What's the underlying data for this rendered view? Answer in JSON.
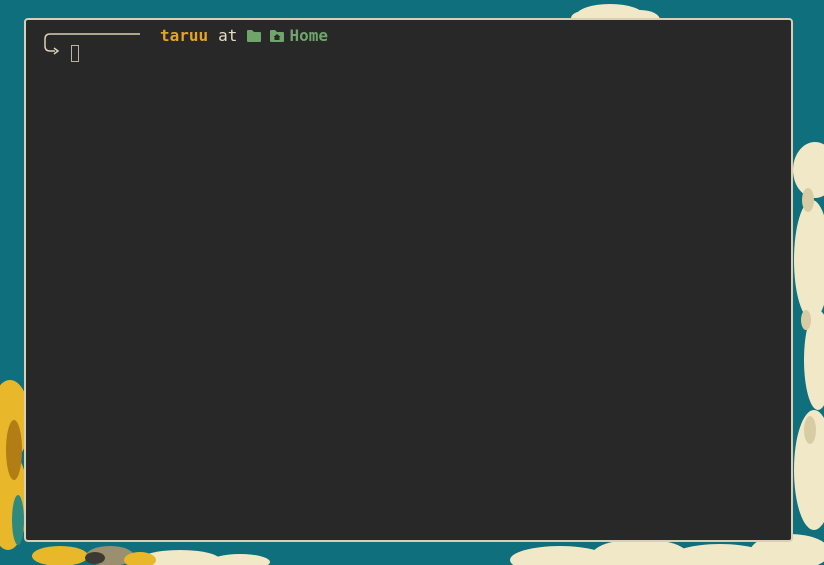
{
  "desktop": {
    "wallpaper_colors": {
      "sky": "#0f6f7c",
      "cloud": "#f1e8c8",
      "cloud_shadow": "#d8cca4",
      "sunflower": "#e8b82a",
      "sunflower_dark": "#b37d16"
    }
  },
  "terminal": {
    "background": "#282828",
    "border_color": "#d8cfb4",
    "prompt": {
      "user": "taruu",
      "separator": "at",
      "folder_icon": "folder-icon",
      "home_icon": "home-folder-icon",
      "directory": "Home"
    },
    "colors": {
      "user": "#e3a423",
      "text": "#e6dcc4",
      "directory": "#6fa56a",
      "decor": "#d8cfb4"
    }
  }
}
